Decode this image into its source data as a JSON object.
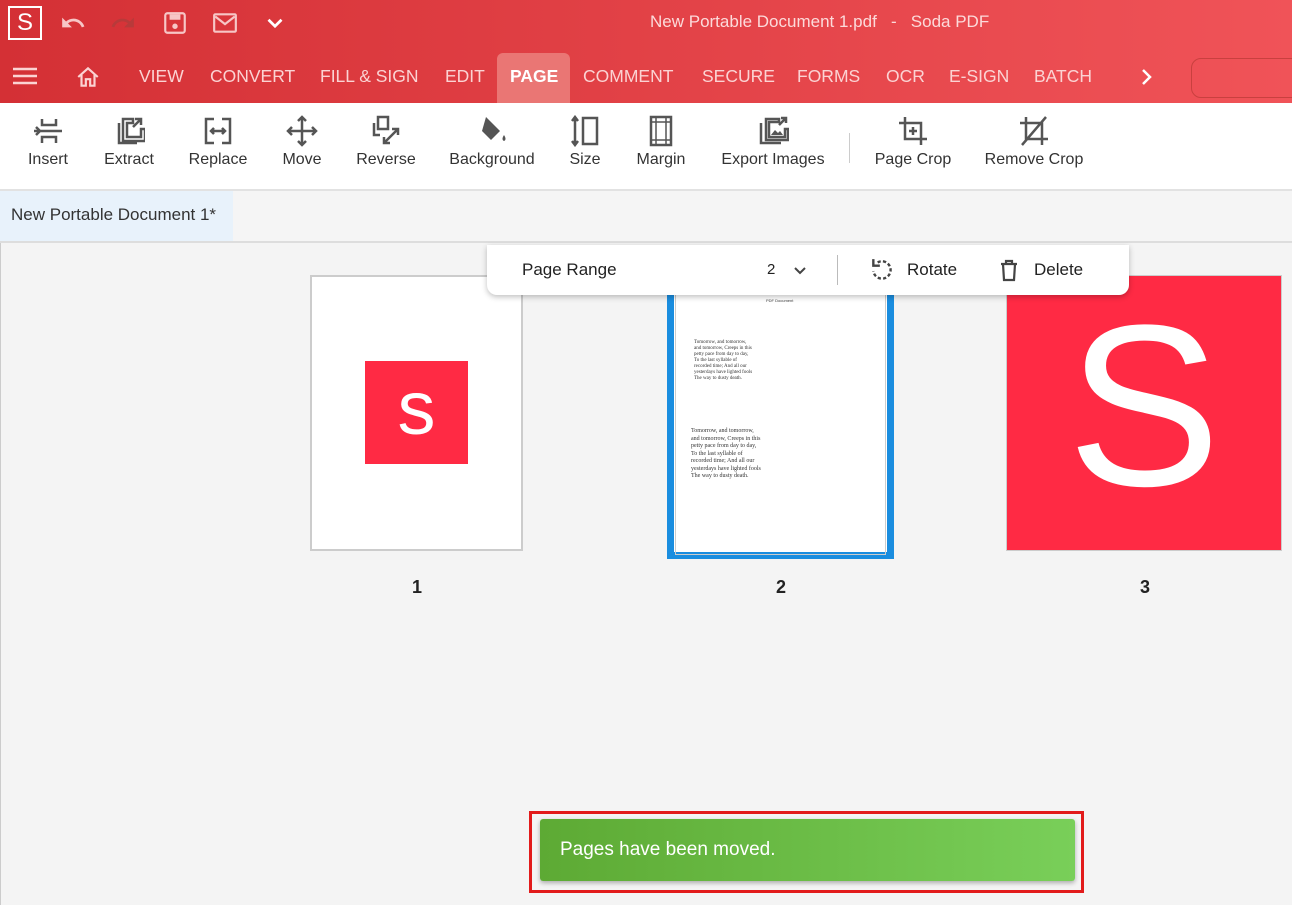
{
  "app": {
    "logo_letter": "S",
    "window_title": "New Portable Document 1.pdf   -   Soda PDF"
  },
  "nav": {
    "items": [
      "VIEW",
      "CONVERT",
      "FILL & SIGN",
      "EDIT",
      "PAGE",
      "COMMENT",
      "SECURE",
      "FORMS",
      "OCR",
      "E-SIGN",
      "BATCH"
    ],
    "active": "PAGE"
  },
  "toolbar": {
    "tools": [
      "Insert",
      "Extract",
      "Replace",
      "Move",
      "Reverse",
      "Background",
      "Size",
      "Margin",
      "Export Images",
      "Page Crop",
      "Remove Crop"
    ]
  },
  "document_tab": "New Portable Document 1*",
  "floating_bar": {
    "page_range_label": "Page Range",
    "page_range_value": "2",
    "rotate": "Rotate",
    "delete": "Delete"
  },
  "pages": [
    {
      "label": "1",
      "logo_letter": "s"
    },
    {
      "label": "2",
      "header": "PDF Document",
      "text": "Tomorrow, and tomorrow, and tomorrow, Creeps in this petty pace from day to day, To the last syllable of recorded time; And all our yesterdays have lighted fools The way to dusty death.",
      "selected": true
    },
    {
      "label": "3",
      "logo_letter": "S"
    }
  ],
  "toast": {
    "message": "Pages have been moved."
  },
  "colors": {
    "brand": "#e03a3e",
    "logo_red": "#ff2a44",
    "selection": "#1a8ddf",
    "toast": "#6abd46"
  }
}
